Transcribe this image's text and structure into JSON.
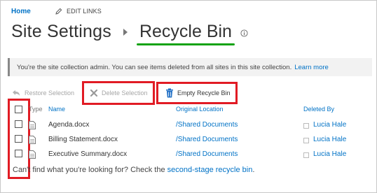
{
  "nav": {
    "home": "Home",
    "edit_links": "EDIT LINKS"
  },
  "title": {
    "site": "Site Settings",
    "page": "Recycle Bin"
  },
  "banner": {
    "message": "You're the site collection admin. You can see items deleted from all sites in this site collection.",
    "learn_more": "Learn more"
  },
  "toolbar": {
    "restore_label": "Restore Selection",
    "delete_label": "Delete Selection",
    "empty_label": "Empty Recycle Bin"
  },
  "table": {
    "headers": {
      "type": "Type",
      "name": "Name",
      "original_location": "Original Location",
      "deleted_by": "Deleted By"
    },
    "rows": [
      {
        "name": "Agenda.docx",
        "location": "/Shared Documents",
        "deleted_by": "Lucia Hale"
      },
      {
        "name": "Billing Statement.docx",
        "location": "/Shared Documents",
        "deleted_by": "Lucia Hale"
      },
      {
        "name": "Executive Summary.docx",
        "location": "/Shared Documents",
        "deleted_by": "Lucia Hale"
      }
    ]
  },
  "footer": {
    "text": "Can't find what you're looking for? Check the ",
    "link": "second-stage recycle bin",
    "end": "."
  },
  "colors": {
    "link": "#0072c6",
    "highlight_box": "#e11b24",
    "title_underline": "#13a313",
    "disabled": "#a6a6a6"
  },
  "icons": {
    "edit": "pencil-icon",
    "separator": "chevron-right-icon",
    "info": "info-icon",
    "restore": "undo-icon",
    "delete": "x-icon",
    "empty": "trash-icon",
    "file": "word-doc-icon"
  }
}
